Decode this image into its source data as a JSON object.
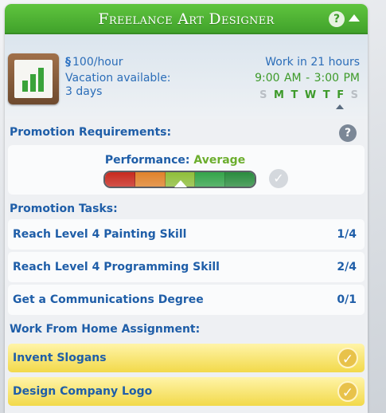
{
  "header": {
    "title": "Freelance Art Designer",
    "help_icon": "question-icon",
    "collapse_icon": "triangle-up-icon"
  },
  "career": {
    "icon": "growth-chart-icon",
    "currency_symbol": "§",
    "wage": "100/hour",
    "vacation_line1": "Vacation available:",
    "vacation_line2": "3 days",
    "work_in": "Work in 21 hours",
    "hours": "9:00  AM - 3:00  PM",
    "days": [
      {
        "letter": "S",
        "active": false
      },
      {
        "letter": "M",
        "active": true
      },
      {
        "letter": "T",
        "active": true
      },
      {
        "letter": "W",
        "active": true
      },
      {
        "letter": "T",
        "active": true
      },
      {
        "letter": "F",
        "active": true
      },
      {
        "letter": "S",
        "active": false
      }
    ],
    "today_index": 4
  },
  "promotion": {
    "title": "Promotion Requirements:",
    "performance_label": "Performance:",
    "performance_value": "Average",
    "performance_level": 0.5,
    "meter_colors": [
      "#c8291e",
      "#e0822a",
      "#8fbe3a",
      "#34a44a",
      "#2a8c3e"
    ]
  },
  "tasks": {
    "title": "Promotion Tasks:",
    "items": [
      {
        "label": "Reach Level 4 Painting Skill",
        "count": "1/4"
      },
      {
        "label": "Reach Level 4 Programming Skill",
        "count": "2/4"
      },
      {
        "label": "Get a Communications Degree",
        "count": "0/1"
      }
    ]
  },
  "assignments": {
    "title": "Work From Home Assignment:",
    "items": [
      {
        "label": "Invent Slogans"
      },
      {
        "label": "Design Company Logo"
      }
    ]
  },
  "colors": {
    "header_green": "#4cb234",
    "text_blue": "#1f5ea8",
    "accent_green": "#3d9a29",
    "assignment_yellow": "#f2d94a"
  }
}
